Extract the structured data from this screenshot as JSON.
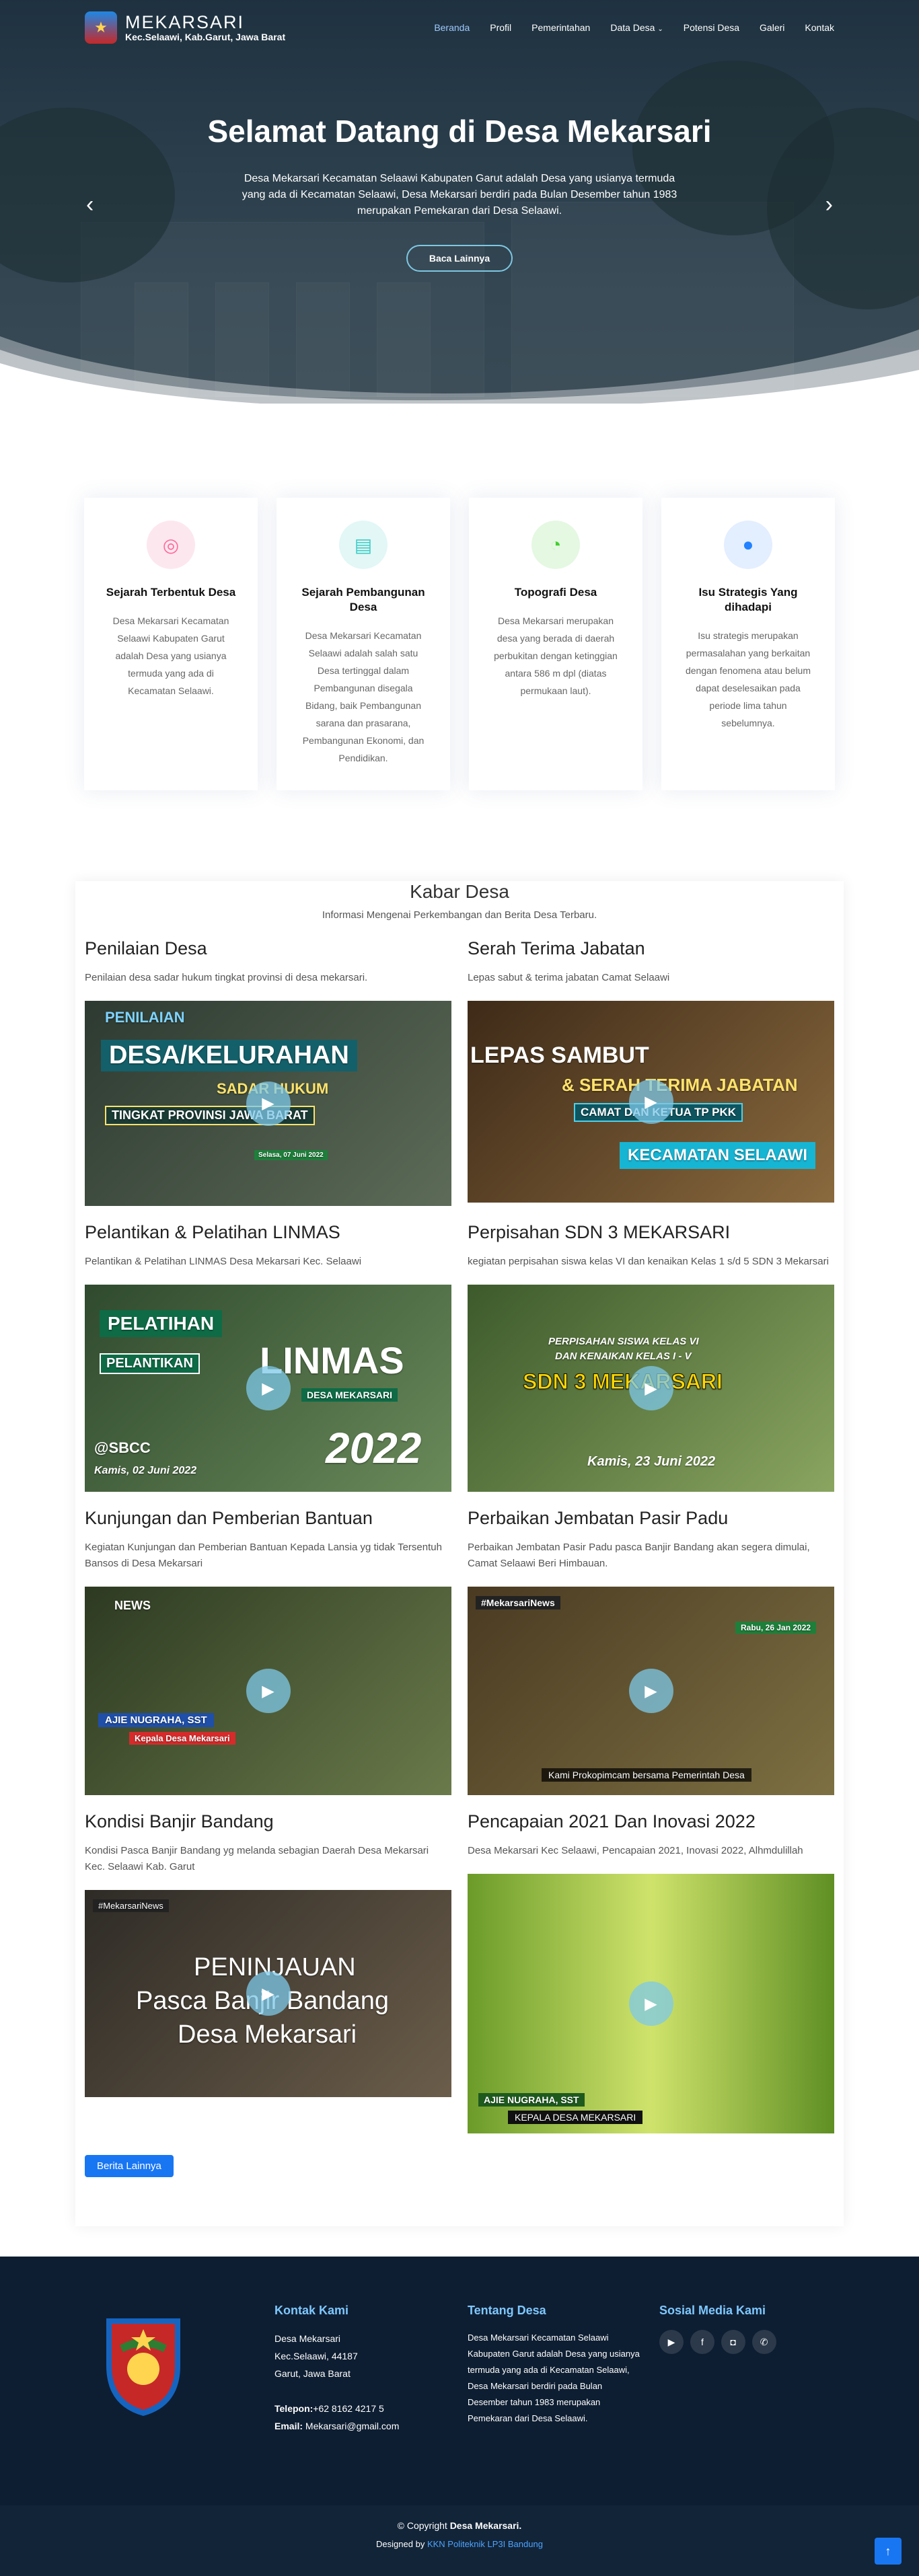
{
  "brand": {
    "title": "MEKARSARI",
    "subtitle": "Kec.Selaawi, Kab.Garut, Jawa Barat"
  },
  "nav": {
    "items": [
      "Beranda",
      "Profil",
      "Pemerintahan",
      "Data Desa",
      "Potensi Desa",
      "Galeri",
      "Kontak"
    ],
    "active": "Beranda"
  },
  "hero": {
    "title": "Selamat Datang di Desa Mekarsari",
    "description": "Desa Mekarsari Kecamatan Selaawi Kabupaten Garut adalah Desa yang usianya termuda yang ada di Kecamatan Selaawi, Desa Mekarsari berdiri pada Bulan Desember tahun 1983 merupakan Pemekaran dari Desa Selaawi.",
    "button": "Baca Lainnya"
  },
  "features": [
    {
      "icon": "dribbble-icon",
      "color": "#ff689b",
      "bg": "#fde7ee",
      "title": "Sejarah Terbentuk Desa",
      "text": "Desa Mekarsari Kecamatan Selaawi Kabupaten Garut adalah Desa yang usianya termuda yang ada di Kecamatan Selaawi."
    },
    {
      "icon": "document-icon",
      "color": "#3fcdc7",
      "bg": "#e2f7f6",
      "title": "Sejarah Pembangunan Desa",
      "text": "Desa Mekarsari Kecamatan Selaawi adalah salah satu Desa tertinggal dalam Pembangunan disegala Bidang, baik Pembangunan sarana dan prasarana, Pembangunan Ekonomi, dan Pendidikan."
    },
    {
      "icon": "speedometer-icon",
      "color": "#41cf2e",
      "bg": "#e5f8e2",
      "title": "Topografi Desa",
      "text": "Desa Mekarsari merupakan desa yang berada di daerah perbukitan dengan ketinggian antara 586 m dpl (diatas permukaan laut)."
    },
    {
      "icon": "globe-icon",
      "color": "#2282ff",
      "bg": "#e3eeff",
      "title": "Isu Strategis Yang dihadapi",
      "text": "Isu strategis merupakan permasalahan yang berkaitan dengan fenomena atau belum dapat deselesaikan pada periode lima tahun sebelumnya."
    }
  ],
  "news": {
    "title": "Kabar Desa",
    "subtitle": "Informasi Mengenai Perkembangan dan Berita Desa Terbaru.",
    "posts": [
      {
        "title": "Penilaian Desa",
        "desc": "Penilaian desa sadar hukum tingkat provinsi di desa mekarsari.",
        "overlay": [
          "PENILAIAN",
          "DESA/KELURAHAN",
          "SADAR HUKUM",
          "TINGKAT PROVINSI JAWA BARAT",
          "Selasa, 07 Juni 2022"
        ],
        "bg": "#3c4a3e"
      },
      {
        "title": "Serah Terima Jabatan",
        "desc": "Lepas sabut & terima jabatan Camat Selaawi",
        "overlay": [
          "LEPAS SAMBUT",
          "& SERAH TERIMA JABATAN",
          "CAMAT DAN KETUA TP PKK",
          "KECAMATAN SELAAWI"
        ],
        "bg": "#6a5236"
      },
      {
        "title": "Pelantikan & Pelatihan LINMAS",
        "desc": "Pelantikan & Pelatihan LINMAS Desa Mekarsari Kec. Selaawi",
        "overlay": [
          "PELATIHAN",
          "PELANTIKAN",
          "LINMAS",
          "DESA MEKARSARI",
          "2022",
          "@SBCC",
          "Kamis, 02 Juni 2022"
        ],
        "bg": "#3b5a3a"
      },
      {
        "title": "Perpisahan SDN 3 MEKARSARI",
        "desc": "kegiatan perpisahan siswa kelas VI dan kenaikan Kelas 1 s/d 5 SDN 3 Mekarsari",
        "overlay": [
          "PERPISAHAN SISWA KELAS VI",
          "DAN KENAIKAN KELAS I - V",
          "SDN 3 MEKARSARI",
          "Kamis, 23 Juni 2022"
        ],
        "bg": "#4e6a3b"
      },
      {
        "title": "Kunjungan dan Pemberian Bantuan",
        "desc": "Kegiatan Kunjungan dan Pemberian Bantuan Kepada Lansia yg tidak Tersentuh Bansos di Desa Mekarsari",
        "overlay": [
          "NEWS",
          "AJIE NUGRAHA, SST",
          "Kepala Desa Mekarsari"
        ],
        "bg": "#4a5036"
      },
      {
        "title": "Perbaikan Jembatan Pasir Padu",
        "desc": "Perbaikan Jembatan Pasir Padu pasca Banjir Bandang akan segera dimulai, Camat Selaawi Beri Himbauan.",
        "overlay": [
          "#MekarsariNews",
          "Rabu, 26 Jan 2022",
          "Kami Prokopimcam bersama Pemerintah Desa"
        ],
        "bg": "#5d5a3c"
      },
      {
        "title": "Kondisi Banjir Bandang",
        "desc": "Kondisi Pasca Banjir Bandang yg melanda sebagian Daerah Desa Mekarsari Kec. Selaawi Kab. Garut",
        "overlay": [
          "#MekarsariNews",
          "PENINJAUAN",
          "Pasca Banjir Bandang",
          "Desa Mekarsari"
        ],
        "bg": "#4b4538"
      },
      {
        "title": "Pencapaian 2021 Dan Inovasi 2022",
        "desc": "Desa Mekarsari Kec Selaawi, Pencapaian 2021, Inovasi 2022, Alhmdulillah",
        "overlay": [
          "AJIE NUGRAHA, SST",
          "KEPALA DESA MEKARSARI"
        ],
        "bg": "#a6c25a"
      }
    ],
    "more_button": "Berita Lainnya"
  },
  "footer": {
    "contact_title": "Kontak Kami",
    "address": [
      "Desa Mekarsari",
      "Kec.Selaawi, 44187",
      "Garut, Jawa Barat"
    ],
    "phone_label": "Telepon:",
    "phone": "+62 8162 4217 5",
    "email_label": "Email:",
    "email": "Mekarsari@gmail.com",
    "about_title": "Tentang Desa",
    "about_text": "Desa Mekarsari Kecamatan Selaawi Kabupaten Garut adalah Desa yang usianya termuda yang ada di Kecamatan Selaawi, Desa Mekarsari berdiri pada Bulan Desember tahun 1983 merupakan Pemekaran dari Desa Selaawi.",
    "social_title": "Sosial Media Kami",
    "copyright_prefix": "© Copyright ",
    "copyright_name": "Desa Mekarsari.",
    "designed_prefix": "Designed by ",
    "designed_link": "KKN Politeknik LP3I Bandung"
  }
}
